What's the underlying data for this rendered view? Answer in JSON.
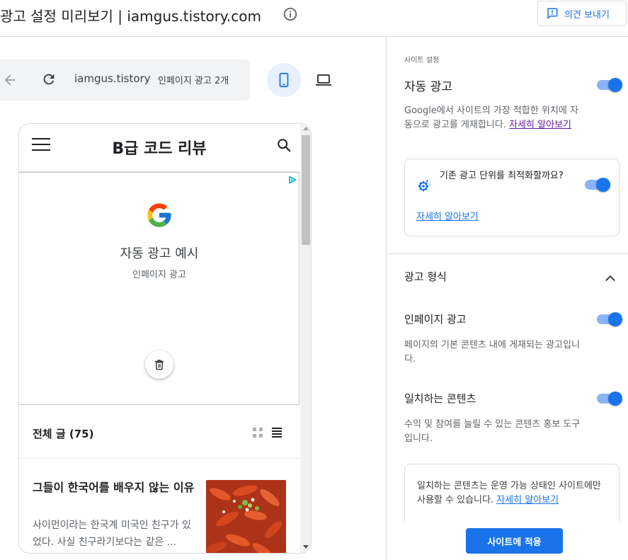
{
  "header": {
    "title": "광고 설정 미리보기 | iamgus.tistory.com",
    "info_icon": "info-icon",
    "feedback_label": "의견 보내기",
    "feedback_icon": "feedback-icon"
  },
  "toolbar": {
    "url": "iamgus.tistory",
    "ad_count": "인페이지 광고 2개",
    "back_icon": "arrow-back-icon",
    "reload_icon": "refresh-icon",
    "mobile_icon": "smartphone-icon",
    "desktop_icon": "laptop-icon",
    "selected_device": "mobile"
  },
  "blog": {
    "title": "B급 코드 리뷰",
    "ad_title": "자동 광고 예시",
    "ad_subtitle": "인페이지 광고",
    "list_title": "전체 글 (75)",
    "post": {
      "title": "그들이 한국어를 배우지 않는 이유",
      "excerpt": "사이먼이라는 한국계 미국인 친구가 있었다. 사실 친구라기보다는 같은 ..."
    }
  },
  "settings": {
    "section_label": "사이트 설정",
    "auto_ads": {
      "label": "자동 광고",
      "enabled": true,
      "desc": "Google에서 사이트의 가장 적합한 위치에 자동으로 광고를 게재합니다.",
      "link": "자세히 알아보기"
    },
    "optimize": {
      "text": "기존 광고 단위를 최적화할까요?",
      "enabled": true,
      "link": "자세히 알아보기"
    },
    "ad_format": {
      "label": "광고 형식",
      "expanded": true
    },
    "inpage": {
      "label": "인페이지 광고",
      "enabled": true,
      "desc": "페이지의 기본 콘텐츠 내에 게재되는 광고입니다."
    },
    "matched": {
      "label": "일치하는 콘텐츠",
      "enabled": true,
      "desc": "수익 및 참여를 늘릴 수 있는 콘텐츠 홍보 도구입니다."
    },
    "note": {
      "text": "일치하는 콘텐츠는 운영 가능 상태인 사이트에만 사용할 수 있습니다.",
      "link": "자세히 알아보기"
    },
    "apply_label": "사이트에 적용"
  },
  "colors": {
    "accent": "#1a73e8",
    "toggle_track": "#8ab4f8",
    "border": "#dadce0"
  }
}
